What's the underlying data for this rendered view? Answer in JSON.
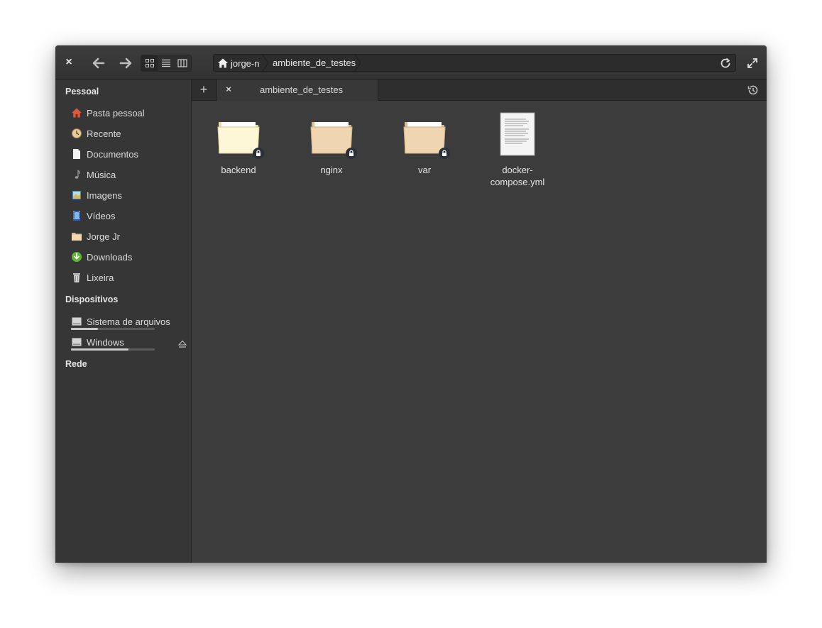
{
  "window": {
    "title_path": [
      "jorge-n",
      "ambiente_de_testes"
    ]
  },
  "toolbar": {
    "close_label": "×",
    "back_icon": "arrow-left-icon",
    "forward_icon": "arrow-right-icon",
    "view_modes": [
      "icon-view",
      "list-view",
      "column-view"
    ],
    "active_view": "icon-view"
  },
  "pathbar": {
    "home_label": "jorge-n",
    "current_label": "ambiente_de_testes"
  },
  "sidebar": {
    "personal_heading": "Pessoal",
    "items": [
      {
        "label": "Pasta pessoal",
        "icon": "home-icon"
      },
      {
        "label": "Recente",
        "icon": "clock-icon"
      },
      {
        "label": "Documentos",
        "icon": "document-icon"
      },
      {
        "label": "Música",
        "icon": "music-note-icon"
      },
      {
        "label": "Imagens",
        "icon": "image-icon"
      },
      {
        "label": "Vídeos",
        "icon": "film-icon"
      },
      {
        "label": "Jorge Jr",
        "icon": "folder-icon"
      },
      {
        "label": "Downloads",
        "icon": "download-icon"
      },
      {
        "label": "Lixeira",
        "icon": "trash-icon"
      }
    ],
    "devices_heading": "Dispositivos",
    "devices": [
      {
        "label": "Sistema de arquivos",
        "icon": "drive-icon",
        "usage": 0.32
      },
      {
        "label": "Windows",
        "icon": "drive-icon",
        "usage": 0.69,
        "ejectable": true
      }
    ],
    "network_heading": "Rede"
  },
  "tabs": {
    "new_tab_label": "+",
    "items": [
      {
        "label": "ambiente_de_testes",
        "close_label": "×"
      }
    ]
  },
  "content": {
    "files": [
      {
        "name": "backend",
        "type": "folder",
        "locked": true,
        "tint": "#fdf7d6"
      },
      {
        "name": "nginx",
        "type": "folder",
        "locked": true,
        "tint": "#f0d6b0"
      },
      {
        "name": "var",
        "type": "folder",
        "locked": true,
        "tint": "#f0d6b0"
      },
      {
        "name": "docker-\ncompose.yml",
        "type": "text-file",
        "locked": false
      }
    ]
  },
  "colors": {
    "window_bg": "#3c3c3c",
    "sidebar_bg": "#363636",
    "download_green": "#5fb636",
    "home_red": "#d65b3f"
  }
}
